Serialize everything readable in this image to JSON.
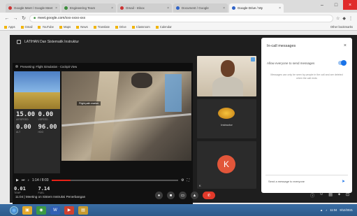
{
  "browser": {
    "tabs": [
      {
        "label": "Google Meet / Google Meet",
        "icon": "meet-icon"
      },
      {
        "label": "Engineering Team",
        "icon": "globe-icon"
      },
      {
        "label": "Gmail - Inbox",
        "icon": "mail-icon"
      },
      {
        "label": "Document / Google",
        "icon": "doc-icon"
      },
      {
        "label": "Google Drive / My",
        "icon": "drive-icon"
      }
    ],
    "active_tab": 4,
    "address": "meet.google.com/xxx-xxxx-xxx",
    "bookmarks": [
      "Apps",
      "Gmail",
      "YouTube",
      "Maps",
      "News",
      "Translate",
      "Drive",
      "Classroom",
      "Calendar",
      "Other bookmarks"
    ]
  },
  "meet": {
    "title": "LATIHAN Dan Sistematik Instruktur",
    "presentation": {
      "header": "Presenting: Flight Simulation - Cockpit View",
      "caption": "Flight path marker",
      "time": "1:14 / 8:03",
      "progress": 0.15,
      "readouts": [
        {
          "value": "15.00",
          "label": "AIRSPEED"
        },
        {
          "value": "0.00",
          "label": "VSPEED"
        },
        {
          "value": "0.00",
          "label": "ALT"
        },
        {
          "value": "96.00",
          "label": "HDG"
        }
      ],
      "extra_readouts": [
        {
          "value": "0.01",
          "label": "TEMP"
        },
        {
          "value": "7.14",
          "label": "FUEL"
        }
      ]
    },
    "participants": [
      {
        "name": "Presenter",
        "type": "camera"
      },
      {
        "name": "Instructor",
        "type": "logo"
      },
      {
        "name": "K",
        "type": "avatar",
        "initial": "K"
      }
    ],
    "side_panel": {
      "title": "In-call messages",
      "toggle_label": "Allow everyone to send messages",
      "note": "Messages can only be seen by people in the call and are deleted when the call ends",
      "input_placeholder": "Send a message to everyone"
    },
    "bottom": {
      "meeting_info": "11:04 | Meeting on Sistem Instruksi Penerbangan"
    }
  },
  "taskbar": {
    "apps": [
      "explorer",
      "chrome",
      "word",
      "media",
      "folder"
    ],
    "clock": "11:04",
    "date": "9/12/2021"
  }
}
